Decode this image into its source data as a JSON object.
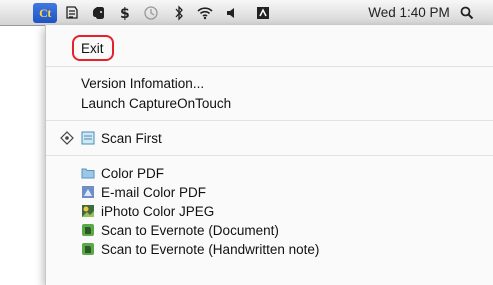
{
  "menubar": {
    "app_icon_text": "Ct",
    "status_icons": [
      "scanner-icon",
      "evernote-icon",
      "money-icon",
      "time-machine-icon",
      "bluetooth-icon",
      "wifi-icon",
      "volume-icon",
      "black-square-icon"
    ],
    "clock": "Wed 1:40 PM",
    "search_icon": "spotlight-search-icon"
  },
  "menu": {
    "items": {
      "exit": "Exit",
      "version": "Version Infomation...",
      "launch": "Launch CaptureOnTouch",
      "scan_first": "Scan First",
      "color_pdf": "Color PDF",
      "email_pdf": "E-mail Color PDF",
      "iphoto": "iPhoto Color JPEG",
      "evernote_doc": "Scan to Evernote (Document)",
      "evernote_hand": "Scan to Evernote (Handwritten note)"
    },
    "highlight_color": "#e5222c"
  }
}
